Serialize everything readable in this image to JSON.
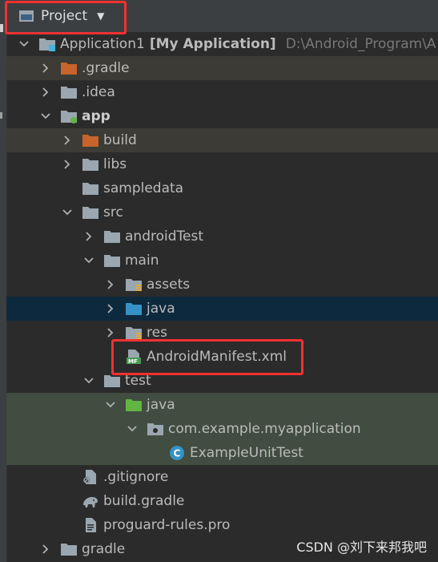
{
  "header": {
    "project_label": "Project"
  },
  "tree": [
    {
      "label": "Application1",
      "extra": "[My Application]",
      "path": "D:\\Android_Program\\A",
      "indent": 0,
      "arrow": "down",
      "icon": "module-folder-icon",
      "bold": false
    },
    {
      "label": ".gradle",
      "indent": 1,
      "arrow": "right",
      "icon": "orange-folder-icon",
      "bg": "orange"
    },
    {
      "label": ".idea",
      "indent": 1,
      "arrow": "right",
      "icon": "grey-folder-icon"
    },
    {
      "label": "app",
      "indent": 1,
      "arrow": "down",
      "icon": "android-module-folder-icon",
      "bold": true
    },
    {
      "label": "build",
      "indent": 2,
      "arrow": "right",
      "icon": "orange-folder-icon",
      "bg": "orange"
    },
    {
      "label": "libs",
      "indent": 2,
      "arrow": "right",
      "icon": "grey-folder-icon"
    },
    {
      "label": "sampledata",
      "indent": 2,
      "arrow": "none",
      "icon": "grey-folder-icon"
    },
    {
      "label": "src",
      "indent": 2,
      "arrow": "down",
      "icon": "grey-folder-icon"
    },
    {
      "label": "androidTest",
      "indent": 3,
      "arrow": "right",
      "icon": "grey-folder-icon"
    },
    {
      "label": "main",
      "indent": 3,
      "arrow": "down",
      "icon": "grey-folder-icon"
    },
    {
      "label": "assets",
      "indent": 4,
      "arrow": "right",
      "icon": "resource-folder-icon"
    },
    {
      "label": "java",
      "indent": 4,
      "arrow": "right",
      "icon": "blue-source-folder-icon",
      "bg": "selected"
    },
    {
      "label": "res",
      "indent": 4,
      "arrow": "right",
      "icon": "resource-folder-icon"
    },
    {
      "label": "AndroidManifest.xml",
      "indent": 4,
      "arrow": "none",
      "icon": "manifest-file-icon"
    },
    {
      "label": "test",
      "indent": 3,
      "arrow": "down",
      "icon": "grey-folder-icon"
    },
    {
      "label": "java",
      "indent": 4,
      "arrow": "down",
      "icon": "green-test-folder-icon",
      "bg": "green"
    },
    {
      "label": "com.example.myapplication",
      "indent": 5,
      "arrow": "down",
      "icon": "package-icon",
      "bg": "green"
    },
    {
      "label": "ExampleUnitTest",
      "indent": 6,
      "arrow": "none",
      "icon": "class-icon",
      "bg": "green"
    },
    {
      "label": ".gitignore",
      "indent": 2,
      "arrow": "none",
      "icon": "gitignore-file-icon"
    },
    {
      "label": "build.gradle",
      "indent": 2,
      "arrow": "none",
      "icon": "gradle-elephant-icon"
    },
    {
      "label": "proguard-rules.pro",
      "indent": 2,
      "arrow": "none",
      "icon": "text-file-icon"
    },
    {
      "label": "gradle",
      "indent": 1,
      "arrow": "right",
      "icon": "grey-folder-icon"
    }
  ],
  "watermark": "CSDN @刘下来邦我吧",
  "colors": {
    "folder_grey": "#9aa7b0",
    "folder_orange": "#c7642b",
    "folder_blue": "#3592c4",
    "folder_green": "#62b543",
    "highlight_red": "#f23131"
  }
}
